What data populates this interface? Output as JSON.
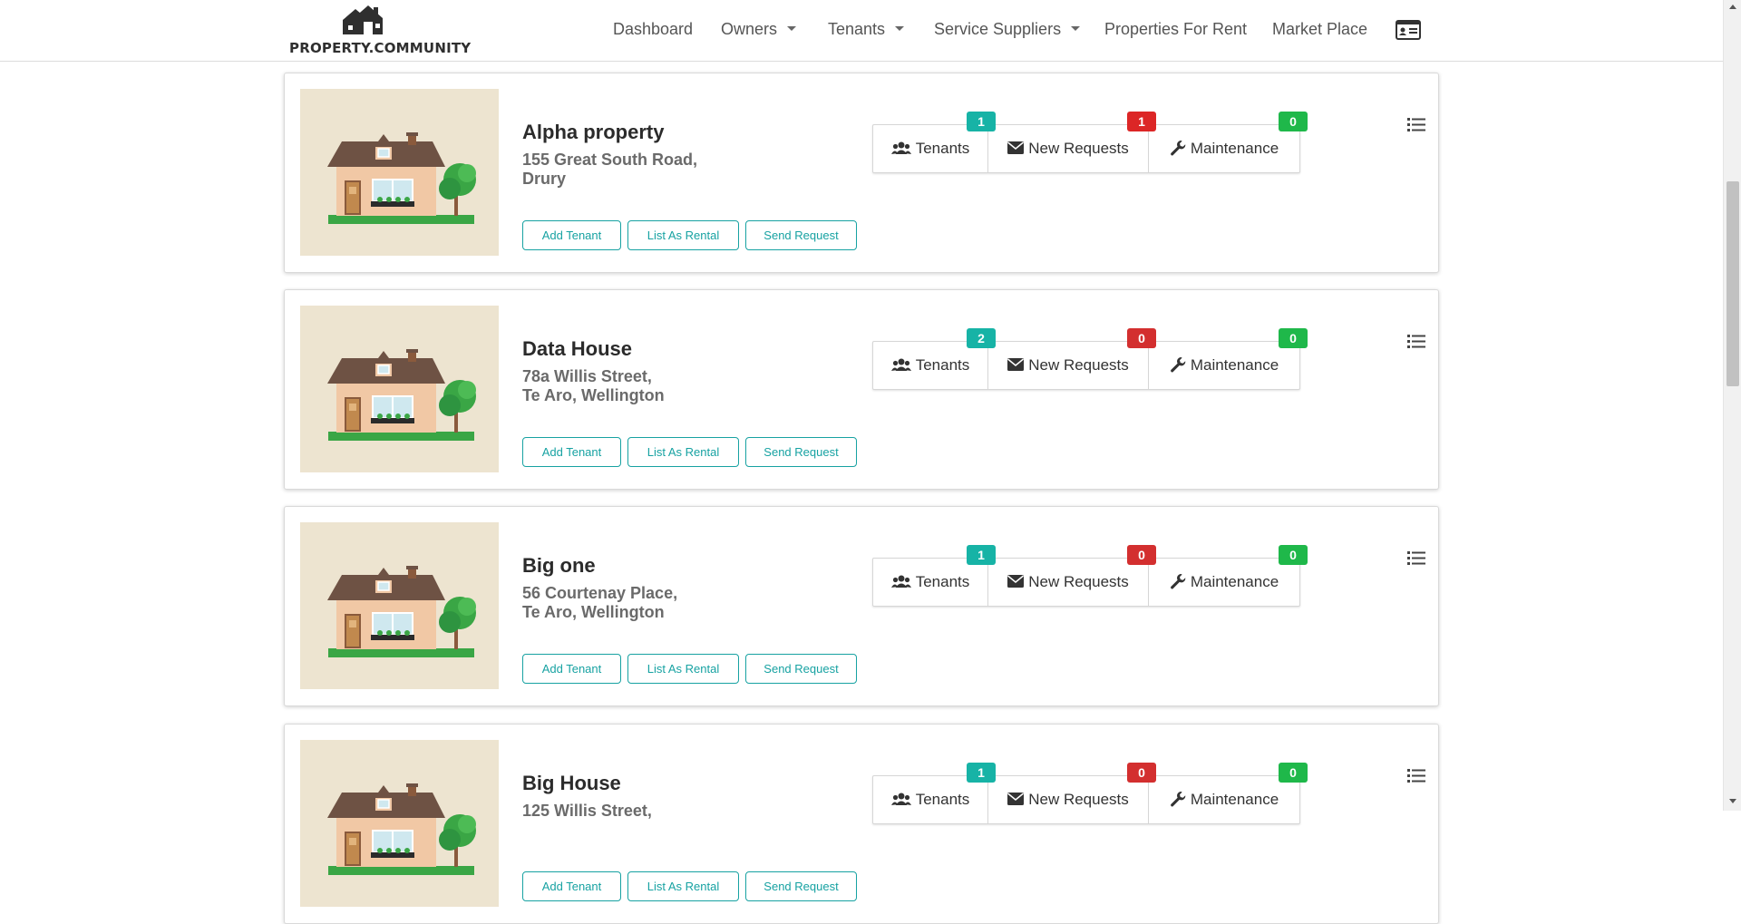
{
  "brand": {
    "logo_text": "PROPERTY.COMMUNITY"
  },
  "nav": {
    "items": [
      {
        "label": "Dashboard",
        "dropdown": false
      },
      {
        "label": "Owners",
        "dropdown": true
      },
      {
        "label": "Tenants",
        "dropdown": true
      },
      {
        "label": "Service Suppliers",
        "dropdown": true
      },
      {
        "label": "Properties For Rent",
        "dropdown": false
      },
      {
        "label": "Market Place",
        "dropdown": false
      }
    ],
    "profile_icon": "id-card-icon"
  },
  "labels": {
    "add_tenant": "Add Tenant",
    "list_as_rental": "List As Rental",
    "send_request": "Send Request",
    "tenants": "Tenants",
    "new_requests": "New Requests",
    "maintenance": "Maintenance"
  },
  "colors": {
    "accent": "#17a2a2",
    "tenants_badge": "#17b3a6",
    "requests_badge_nonzero": "#dc2626",
    "requests_badge_zero": "#d32f2f",
    "maintenance_badge": "#1fb84a"
  },
  "properties": [
    {
      "name": "Alpha property",
      "address_line1": "155 Great South Road,",
      "address_line2": "Drury",
      "tenants": "1",
      "new_requests": "1",
      "maintenance": "0"
    },
    {
      "name": "Data House",
      "address_line1": "78a Willis Street,",
      "address_line2": "Te Aro, Wellington",
      "tenants": "2",
      "new_requests": "0",
      "maintenance": "0"
    },
    {
      "name": "Big one",
      "address_line1": "56 Courtenay Place,",
      "address_line2": "Te Aro, Wellington",
      "tenants": "1",
      "new_requests": "0",
      "maintenance": "0"
    },
    {
      "name": "Big House",
      "address_line1": "125 Willis Street,",
      "address_line2": "",
      "tenants": "1",
      "new_requests": "0",
      "maintenance": "0"
    }
  ]
}
